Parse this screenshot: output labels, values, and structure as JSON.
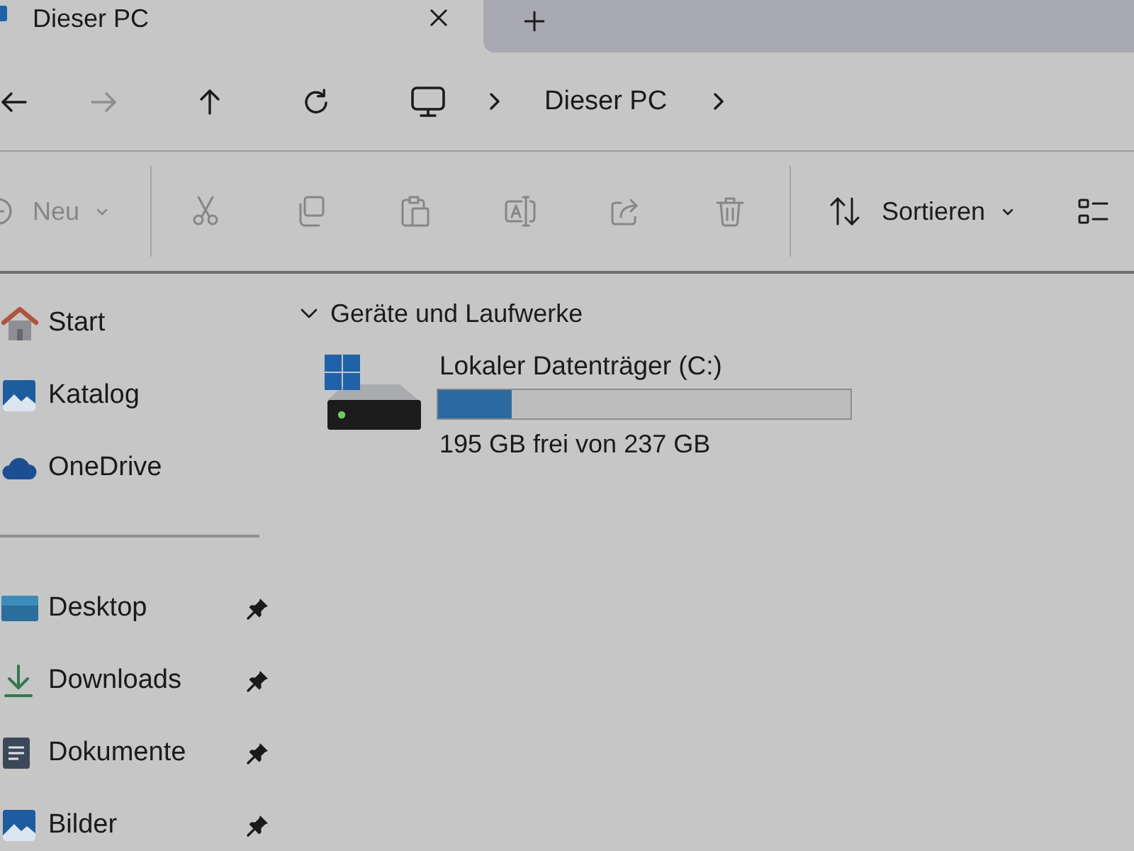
{
  "tabs": [
    {
      "label": "Dieser PC",
      "selected": true
    }
  ],
  "navigation": {
    "buttons": [
      {
        "kind": "back",
        "disabled": false
      },
      {
        "kind": "forward",
        "disabled": true
      },
      {
        "kind": "up",
        "disabled": false
      },
      {
        "kind": "refresh",
        "disabled": false
      }
    ],
    "breadcrumb": [
      "Dieser PC"
    ]
  },
  "toolbar": {
    "groups": [
      {
        "items": [
          {
            "kind": "new",
            "label": "Neu",
            "disabled": true
          }
        ]
      },
      {
        "items": [
          {
            "kind": "cut",
            "disabled": true
          },
          {
            "kind": "copy",
            "disabled": true
          },
          {
            "kind": "paste",
            "disabled": true
          },
          {
            "kind": "rename",
            "disabled": true
          },
          {
            "kind": "share",
            "disabled": true
          },
          {
            "kind": "delete",
            "disabled": true
          }
        ]
      },
      {
        "items": [
          {
            "kind": "sort",
            "label": "Sortieren",
            "disabled": false
          },
          {
            "kind": "view",
            "disabled": false
          }
        ]
      }
    ]
  },
  "sidebar": {
    "groups": [
      {
        "items": [
          {
            "kind": "home",
            "label": "Start",
            "pinned": false
          },
          {
            "kind": "gallery",
            "label": "Katalog",
            "pinned": false
          },
          {
            "kind": "cloud",
            "label": "OneDrive",
            "pinned": false
          }
        ]
      },
      {
        "items": [
          {
            "kind": "desktop",
            "label": "Desktop",
            "pinned": true
          },
          {
            "kind": "downloads",
            "label": "Downloads",
            "pinned": true
          },
          {
            "kind": "documents",
            "label": "Dokumente",
            "pinned": true
          },
          {
            "kind": "pictures",
            "label": "Bilder",
            "pinned": true
          }
        ]
      }
    ]
  },
  "sections": [
    {
      "title": "Geräte und Laufwerke",
      "expanded": true,
      "drives": [
        {
          "name": "Lokaler Datenträger (C:)",
          "level": 0.18,
          "free_space": "195 GB frei von 237 GB"
        }
      ]
    }
  ]
}
